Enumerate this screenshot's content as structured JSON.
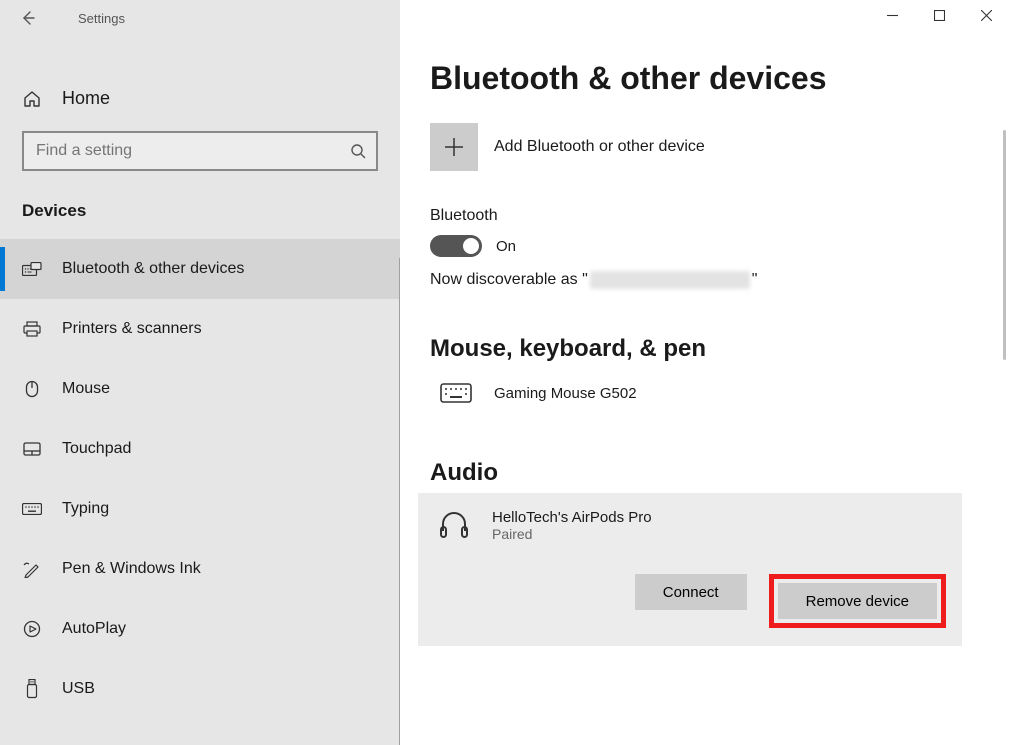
{
  "window": {
    "app_title": "Settings",
    "search_placeholder": "Find a setting",
    "home_label": "Home",
    "category": "Devices"
  },
  "nav": [
    {
      "label": "Bluetooth & other devices"
    },
    {
      "label": "Printers & scanners"
    },
    {
      "label": "Mouse"
    },
    {
      "label": "Touchpad"
    },
    {
      "label": "Typing"
    },
    {
      "label": "Pen & Windows Ink"
    },
    {
      "label": "AutoPlay"
    },
    {
      "label": "USB"
    }
  ],
  "page": {
    "title": "Bluetooth & other devices",
    "add_device_label": "Add Bluetooth or other device",
    "bluetooth_label": "Bluetooth",
    "bluetooth_state": "On",
    "discoverable_prefix": "Now discoverable as \"",
    "discoverable_suffix": "\"",
    "sections": {
      "mouse_heading": "Mouse, keyboard, & pen",
      "mouse_device": "Gaming Mouse G502",
      "audio_heading": "Audio",
      "audio_device_name": "HelloTech's AirPods Pro",
      "audio_device_status": "Paired",
      "connect_label": "Connect",
      "remove_label": "Remove device"
    }
  }
}
